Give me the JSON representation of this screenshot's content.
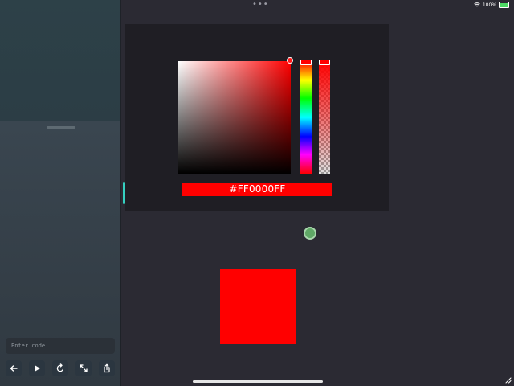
{
  "status_bar": {
    "battery": "100%",
    "more_dots": "•••"
  },
  "sidebar": {
    "code_input": {
      "placeholder": "Enter code",
      "value": ""
    },
    "toolbar": {
      "icons": [
        "arrow-left-icon",
        "play-icon",
        "refresh-icon",
        "expand-icon",
        "share-icon"
      ]
    }
  },
  "color_picker": {
    "hex_value": "#FF0000FF",
    "selected_color": "#ff0000",
    "hue": 0,
    "alpha": 1
  },
  "preview": {
    "color": "#ff0000"
  },
  "colors": {
    "accent": "#35d0c0",
    "green_dot": "#5fa866",
    "panel_bg": "#1f1e24",
    "canvas_bg": "#2b2a33"
  }
}
